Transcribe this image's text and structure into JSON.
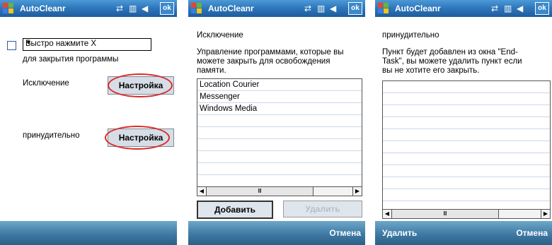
{
  "app_title": "AutoCleanr",
  "ok_label": "ok",
  "screen1": {
    "combo_value": "Быстро нажмите X",
    "close_caption": "для закрытия программы",
    "exclusion_label": "Исключение",
    "forced_label": "принудительно",
    "setup_label": "Настройка"
  },
  "screen2": {
    "heading": "Исключение",
    "desc_line1": "Управление программами, которые вы",
    "desc_line2": "можете закрыть  для освобождения",
    "desc_line3": "памяти.",
    "items": [
      "Location Courier",
      "Messenger",
      "Windows Media"
    ],
    "add_label": "Добавить",
    "remove_label": "Удалить",
    "cancel_label": "Отмена"
  },
  "screen3": {
    "heading": "принудительно",
    "desc_line1": "Пункт будет добавлен из окна \"End-",
    "desc_line2": "Task\", вы можете удалить пункт если",
    "desc_line3": "вы не хотите его закрыть.",
    "remove_label": "Удалить",
    "cancel_label": "Отмена"
  },
  "icons": [
    "windows-logo-icon",
    "connectivity-icon",
    "signal-icon",
    "speaker-icon",
    "scroll-left-icon",
    "scroll-right-icon"
  ],
  "colors": {
    "titlebar": "#2f78bd",
    "bottombar": "#3e7aa5",
    "highlight_ring": "#d72b2b"
  }
}
